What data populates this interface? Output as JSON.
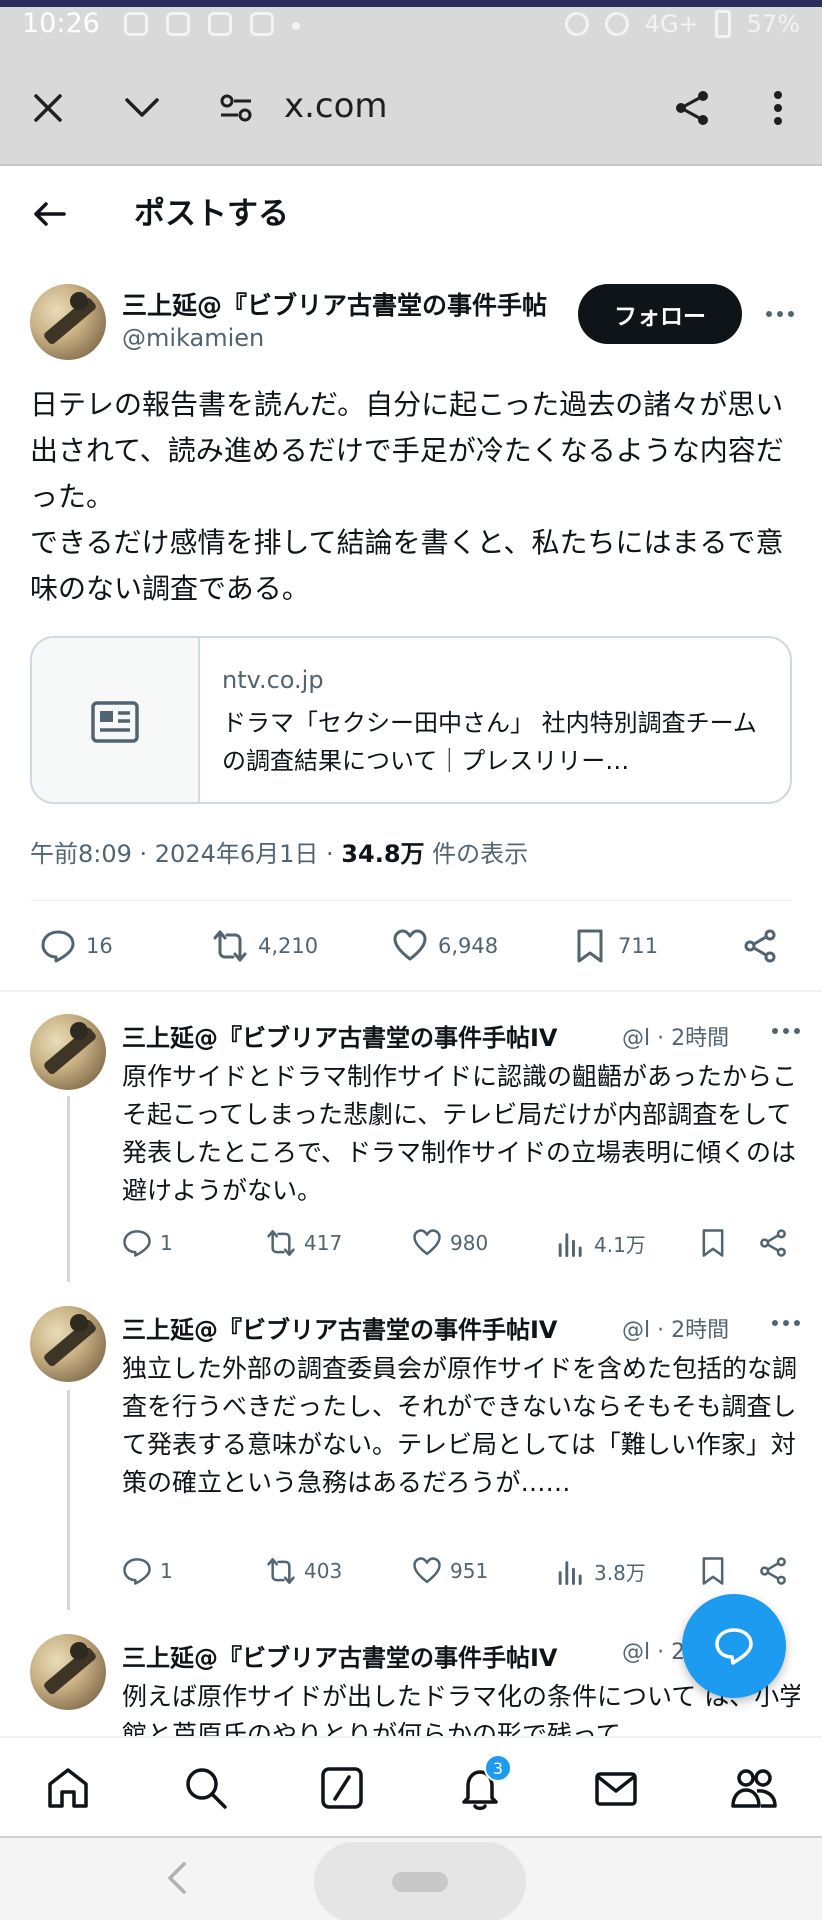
{
  "status_bar": {
    "time": "10:26",
    "network": "4G+",
    "battery": "57%"
  },
  "browser": {
    "url": "x.com",
    "close_icon": "close-icon",
    "menu_icon": "more-vertical-icon"
  },
  "page": {
    "title": "ポストする"
  },
  "main_post": {
    "author_name": "三上延@『ビブリア古書堂の事件手帖",
    "author_handle": "@mikamien",
    "follow_label": "フォロー",
    "text": "日テレの報告書を読んだ。自分に起こった過去の諸々が思い出されて、読み進めるだけで手足が冷たくなるような内容だった。\nできるだけ感情を排して結論を書くと、私たちにはまるで意味のない調査である。",
    "link": {
      "domain": "ntv.co.jp",
      "title": "ドラマ「セクシー田中さん」 社内特別調査チームの調査結果について｜プレスリリー…"
    },
    "timestamp": "午前8:09 · 2024年6月1日 · ",
    "views_count": "34.8万",
    "views_label": " 件の表示",
    "replies": "16",
    "reposts": "4,210",
    "likes": "6,948",
    "bookmarks": "711"
  },
  "replies": [
    {
      "author_name": "三上延@『ビブリア古書堂の事件手帖IV",
      "meta": "@l · 2時間",
      "text": "原作サイドとドラマ制作サイドに認識の齟齬があったからこそ起こってしまった悲劇に、テレビ局だけが内部調査をして発表したところで、ドラマ制作サイドの立場表明に傾くのは避けようがない。",
      "replies": "1",
      "reposts": "417",
      "likes": "980",
      "views": "4.1万"
    },
    {
      "author_name": "三上延@『ビブリア古書堂の事件手帖IV",
      "meta": "@l · 2時間",
      "text": "独立した外部の調査委員会が原作サイドを含めた包括的な調査を行うべきだったし、それができないならそもそも調査して発表する意味がない。テレビ局としては「難しい作家」対策の確立という急務はあるだろうが……",
      "replies": "1",
      "reposts": "403",
      "likes": "951",
      "views": "3.8万"
    },
    {
      "author_name": "三上延@『ビブリア古書堂の事件手帖IV",
      "meta": "@l · 2",
      "text": "例えば原作サイドが出したドラマ化の条件について は、小学館と芦原氏のやりとりが何らかの形で残って"
    }
  ],
  "bottom_nav": {
    "notifications_badge": "3"
  },
  "colors": {
    "accent": "#1d9bf0",
    "text": "#0f1419",
    "muted": "#536471"
  }
}
